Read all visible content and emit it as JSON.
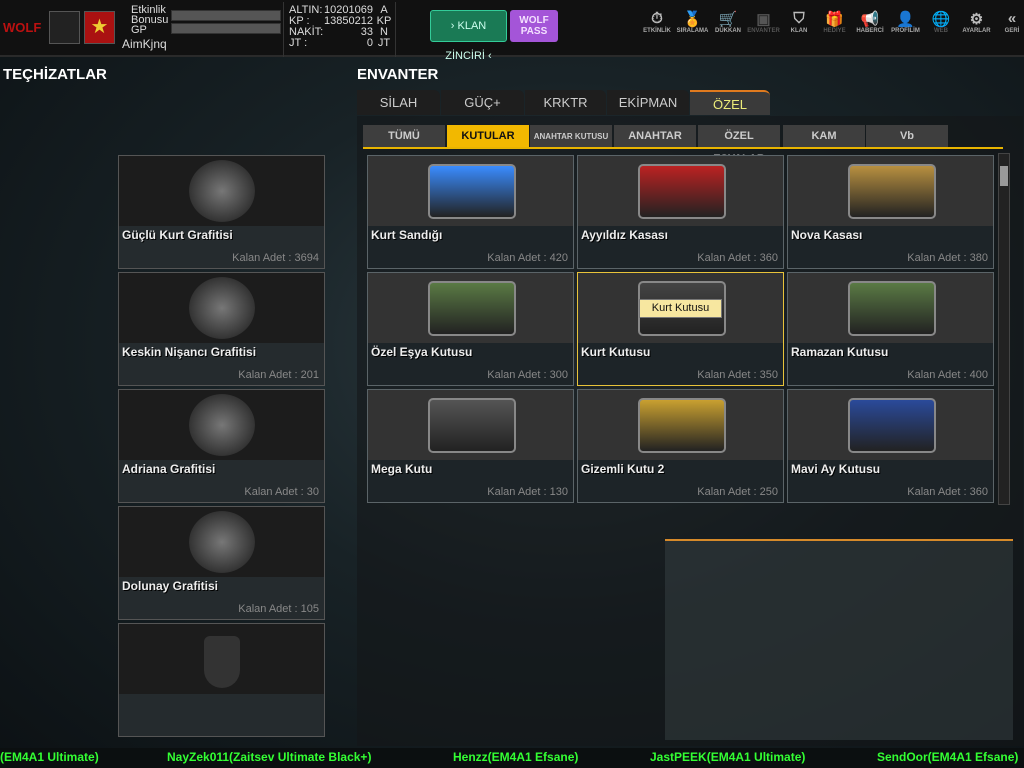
{
  "header": {
    "event_bonus_label": "Etkinlik Bonusu",
    "gp_label": "GP",
    "username": "AimKjnq",
    "currencies": [
      {
        "label": "ALTIN:",
        "value": "10201069",
        "unit": "A"
      },
      {
        "label": "KP :",
        "value": "13850212",
        "unit": "KP"
      },
      {
        "label": "NAKİT:",
        "value": "33",
        "unit": "N"
      },
      {
        "label": "JT :",
        "value": "0",
        "unit": "JT"
      }
    ],
    "clan_chain": "› KLAN ZİNCİRİ ‹",
    "wolf_pass": "WOLF PASS",
    "nav": [
      {
        "label": "ETKİNLİK",
        "icon": "⏱"
      },
      {
        "label": "SIRALAMA",
        "icon": "🏅"
      },
      {
        "label": "DÜKKAN",
        "icon": "🛒"
      },
      {
        "label": "ENVANTER",
        "icon": "▣"
      },
      {
        "label": "KLAN",
        "icon": "⛉"
      },
      {
        "label": "HEDİYE",
        "icon": "🎁"
      },
      {
        "label": "HABERCİ",
        "icon": "📢"
      },
      {
        "label": "PROFİLİM",
        "icon": "👤"
      },
      {
        "label": "WEB",
        "icon": "🌐"
      },
      {
        "label": "AYARLAR",
        "icon": "⚙"
      },
      {
        "label": "GERİ",
        "icon": "«"
      }
    ]
  },
  "left": {
    "title": "TEÇHİZATLAR",
    "items": [
      {
        "name": "Güçlü Kurt Grafitisi",
        "count": "Kalan Adet : 3694"
      },
      {
        "name": "Keskin Nişancı Grafitisi",
        "count": "Kalan Adet : 201"
      },
      {
        "name": "Adriana Grafitisi",
        "count": "Kalan Adet : 30"
      },
      {
        "name": "Dolunay Grafitisi",
        "count": "Kalan Adet : 105"
      }
    ]
  },
  "inventory": {
    "title": "ENVANTER",
    "tabs": [
      "SİLAH",
      "GÜÇ+",
      "KRKTR",
      "EKİPMAN",
      "ÖZEL"
    ],
    "subtabs": [
      "TÜMÜ",
      "KUTULAR",
      "ANAHTAR KUTUSU",
      "ANAHTAR",
      "ÖZEL EŞYALAR",
      "KAM",
      "Vb"
    ],
    "items": [
      {
        "name": "Kurt Sandığı",
        "count": "Kalan Adet : 420",
        "color": "#3a8cff"
      },
      {
        "name": "Ayyıldız Kasası",
        "count": "Kalan Adet : 360",
        "color": "#b22"
      },
      {
        "name": "Nova Kasası",
        "count": "Kalan Adet : 380",
        "color": "#b89040"
      },
      {
        "name": "Özel Eşya Kutusu",
        "count": "Kalan Adet : 300",
        "color": "#5a7a44"
      },
      {
        "name": "Kurt Kutusu",
        "count": "Kalan Adet : 350",
        "color": "#444"
      },
      {
        "name": "Ramazan Kutusu",
        "count": "Kalan Adet : 400",
        "color": "#5a7a44"
      },
      {
        "name": "Mega Kutu",
        "count": "Kalan Adet : 130",
        "color": "#555"
      },
      {
        "name": "Gizemli Kutu 2",
        "count": "Kalan Adet : 250",
        "color": "#c9a030"
      },
      {
        "name": "Mavi Ay Kutusu",
        "count": "Kalan Adet : 360",
        "color": "#2a4a9a"
      }
    ],
    "tooltip": "Kurt Kutusu"
  },
  "ticker": [
    "(EM4A1 Ultimate)",
    "NayZek011(Zaitsev Ultimate Black+)",
    "Henzz(EM4A1 Efsane)",
    "JastPEEK(EM4A1 Ultimate)",
    "SendOor(EM4A1 Efsane)"
  ]
}
